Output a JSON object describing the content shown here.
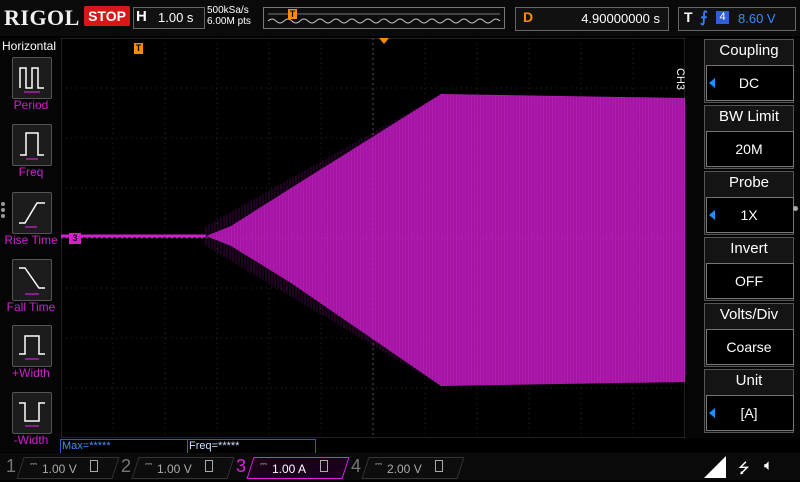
{
  "header": {
    "brand": "RIGOL",
    "run_state": "STOP",
    "horizontal": {
      "label": "H",
      "timebase": "1.00 s"
    },
    "acquisition": {
      "sample_rate": "500kSa/s",
      "memory_depth": "6.00M pts"
    },
    "trigger_pos_marker": "T",
    "delay": {
      "label": "D",
      "value": "4.90000000 s"
    },
    "trigger": {
      "label": "T",
      "source": "4",
      "level": "8.60 V"
    }
  },
  "left_menu": {
    "title": "Horizontal",
    "items": [
      {
        "label": "Period",
        "icon": "period-icon"
      },
      {
        "label": "Freq",
        "icon": "freq-icon"
      },
      {
        "label": "Rise Time",
        "icon": "rise-time-icon"
      },
      {
        "label": "Fall Time",
        "icon": "fall-time-icon"
      },
      {
        "label": "+Width",
        "icon": "pos-width-icon"
      },
      {
        "label": "-Width",
        "icon": "neg-width-icon"
      }
    ]
  },
  "waveform": {
    "channel_marker": "3",
    "trigger_level_marker": "T",
    "trigger_time_marker": "T",
    "color": "#d020d0"
  },
  "right_menu": {
    "channel": "CH3",
    "items": [
      {
        "title": "Coupling",
        "value": "DC",
        "has_arrow": true
      },
      {
        "title": "BW Limit",
        "value": "20M",
        "has_arrow": false
      },
      {
        "title": "Probe",
        "value": "1X",
        "has_arrow": true
      },
      {
        "title": "Invert",
        "value": "OFF",
        "has_arrow": false
      },
      {
        "title": "Volts/Div",
        "value": "Coarse",
        "has_arrow": false
      },
      {
        "title": "Unit",
        "value": "[A]",
        "has_arrow": true
      }
    ]
  },
  "measurements": [
    {
      "text": "Max=*****"
    },
    {
      "text": "Freq=*****"
    }
  ],
  "channels": [
    {
      "num": "1",
      "coupling": "⎓",
      "scale": "1.00 V",
      "color": "#b0b000",
      "active": false
    },
    {
      "num": "2",
      "coupling": "⎓",
      "scale": "1.00 V",
      "color": "#20b0b0",
      "active": false
    },
    {
      "num": "3",
      "coupling": "⎓",
      "scale": "1.00 A",
      "color": "#e020e0",
      "active": true
    },
    {
      "num": "4",
      "coupling": "⎓",
      "scale": "2.00 V",
      "color": "#5a80d0",
      "active": false
    }
  ],
  "colors": {
    "accent_orange": "#ff8c00",
    "ch3": "#d020d0",
    "trigger_blue": "#3a8bff",
    "stop_red": "#d81818"
  }
}
